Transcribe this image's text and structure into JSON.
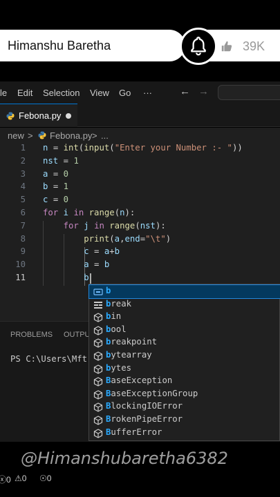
{
  "overlay": {
    "channel_name": "Himanshu Baretha",
    "like_count": "39K",
    "watermark": "@Himanshubaretha6382"
  },
  "menubar": {
    "items": [
      "le",
      "Edit",
      "Selection",
      "View",
      "Go",
      "···"
    ],
    "back_arrow": "←",
    "forward_arrow": "→"
  },
  "tab": {
    "label": "Febona.py",
    "modified": true
  },
  "breadcrumb": {
    "items": [
      "new",
      ">",
      "Febona.py",
      ">",
      "..."
    ]
  },
  "editor": {
    "lines": [
      {
        "n": "1",
        "code": "n = int(input(\"Enter your Number :- \"))"
      },
      {
        "n": "2",
        "code": "nst = 1"
      },
      {
        "n": "3",
        "code": "a = 0"
      },
      {
        "n": "4",
        "code": "b = 1"
      },
      {
        "n": "5",
        "code": "c = 0"
      },
      {
        "n": "6",
        "code": "for i in range(n):"
      },
      {
        "n": "7",
        "code": "    for j in range(nst):"
      },
      {
        "n": "8",
        "code": "        print(a,end=\"\\t\")"
      },
      {
        "n": "9",
        "code": "        c = a+b"
      },
      {
        "n": "10",
        "code": "        a = b"
      },
      {
        "n": "11",
        "code": "        b"
      }
    ],
    "active_line": "11"
  },
  "suggestions": [
    {
      "label": "b",
      "kind": "variable"
    },
    {
      "label": "break",
      "kind": "keyword"
    },
    {
      "label": "bin",
      "kind": "module"
    },
    {
      "label": "bool",
      "kind": "module"
    },
    {
      "label": "breakpoint",
      "kind": "module"
    },
    {
      "label": "bytearray",
      "kind": "module"
    },
    {
      "label": "bytes",
      "kind": "module"
    },
    {
      "label": "BaseException",
      "kind": "module"
    },
    {
      "label": "BaseExceptionGroup",
      "kind": "module"
    },
    {
      "label": "BlockingIOError",
      "kind": "module"
    },
    {
      "label": "BrokenPipeError",
      "kind": "module"
    },
    {
      "label": "BufferError",
      "kind": "module"
    }
  ],
  "panel": {
    "tabs": [
      "PROBLEMS",
      "OUTPUT"
    ],
    "terminal_line": "PS C:\\Users\\Mft"
  },
  "statusbar": {
    "errors": "0",
    "warnings": "0",
    "ports": "0"
  },
  "colors": {
    "editor_bg": "#1f1f1f",
    "accent": "#0078d4",
    "keyword": "#c586c0",
    "function": "#dcdcaa",
    "string": "#ce9178",
    "number": "#b5cea8",
    "variable": "#9cdcfe",
    "class": "#4ec9b0",
    "match_highlight": "#2aaaff"
  }
}
